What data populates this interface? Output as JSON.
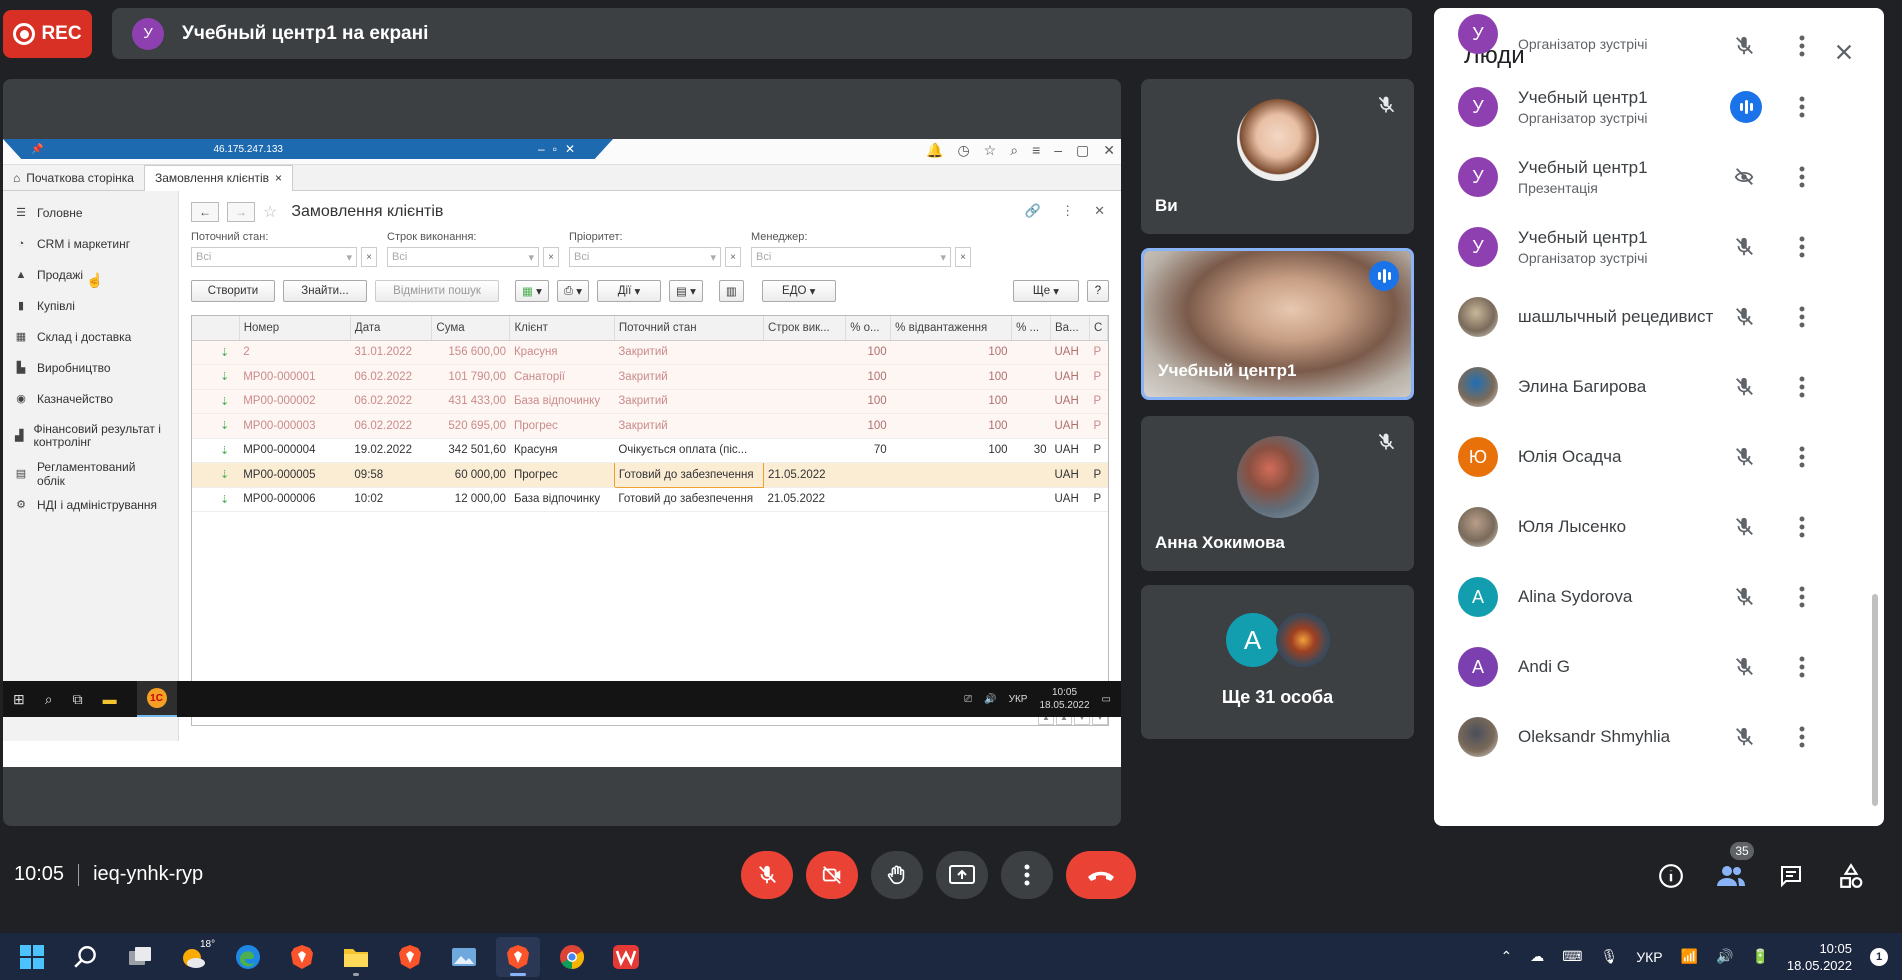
{
  "recording": {
    "label": "REC"
  },
  "presenting": {
    "avatar_letter": "У",
    "title": "Учебный центр1 на екрані"
  },
  "erp": {
    "window_title_ip": "46.175.247.133",
    "tabs": [
      "Початкова сторінка",
      "Замовлення клієнтів"
    ],
    "nav": [
      "Головне",
      "CRM і маркетинг",
      "Продажі",
      "Купівлі",
      "Склад і доставка",
      "Виробництво",
      "Казначейство",
      "Фінансовий результат і контролінг",
      "Регламентований облік",
      "НДІ і адміністрування"
    ],
    "doc_title": "Замовлення клієнтів",
    "filters": [
      {
        "label": "Поточний стан:",
        "value": "Всі"
      },
      {
        "label": "Строк виконання:",
        "value": "Всі"
      },
      {
        "label": "Пріоритет:",
        "value": "Всі"
      },
      {
        "label": "Менеджер:",
        "value": "Всі"
      }
    ],
    "toolbar": {
      "create": "Створити",
      "find": "Знайти...",
      "cancel_search": "Відмінити пошук",
      "actions": "Дії",
      "edo": "ЕДО",
      "more": "Ще",
      "help": "?"
    },
    "columns": [
      "Номер",
      "Дата",
      "Сума",
      "Клієнт",
      "Поточний стан",
      "Строк вик...",
      "% о...",
      "% відвантаження",
      "% ...",
      "Ва...",
      "С"
    ],
    "rows": [
      {
        "state": "closed",
        "cells": [
          "2",
          "31.01.2022",
          "156 600,00",
          "Красуня",
          "Закритий",
          "",
          "100",
          "100",
          "",
          "UAH",
          "Р"
        ]
      },
      {
        "state": "closed",
        "cells": [
          "МР00-000001",
          "06.02.2022",
          "101 790,00",
          "Санаторії",
          "Закритий",
          "",
          "100",
          "100",
          "",
          "UAH",
          "Р"
        ]
      },
      {
        "state": "closed",
        "cells": [
          "МР00-000002",
          "06.02.2022",
          "431 433,00",
          "База відпочинку",
          "Закритий",
          "",
          "100",
          "100",
          "",
          "UAH",
          "Р"
        ]
      },
      {
        "state": "closed",
        "cells": [
          "МР00-000003",
          "06.02.2022",
          "520 695,00",
          "Прогрес",
          "Закритий",
          "",
          "100",
          "100",
          "",
          "UAH",
          "Р"
        ]
      },
      {
        "state": "open",
        "cells": [
          "МР00-000004",
          "19.02.2022",
          "342 501,60",
          "Красуня",
          "Очікується оплата (піс...",
          "",
          "70",
          "100",
          "30",
          "UAH",
          "Р"
        ]
      },
      {
        "state": "sel",
        "cells": [
          "МР00-000005",
          "09:58",
          "60 000,00",
          "Прогрес",
          "Готовий до забезпечення",
          "21.05.2022",
          "",
          "",
          "",
          "UAH",
          "Р"
        ]
      },
      {
        "state": "open",
        "cells": [
          "МР00-000006",
          "10:02",
          "12 000,00",
          "База відпочинку",
          "Готовий до забезпечення",
          "21.05.2022",
          "",
          "",
          "",
          "UAH",
          "Р"
        ]
      }
    ],
    "taskbar": {
      "lang": "УКР",
      "time": "10:05",
      "date": "18.05.2022"
    }
  },
  "tiles": {
    "you": {
      "name": "Ви"
    },
    "speaker": {
      "name": "Учебный центр1"
    },
    "anna": {
      "name": "Анна Хокимова"
    },
    "more": {
      "letter": "A",
      "text": "Ще 31 особа"
    }
  },
  "people": {
    "title": "Люди",
    "list": [
      {
        "name": "",
        "role": "Організатор зустрічі",
        "avatar": "У",
        "color": "#8e3fb0",
        "mic": "muted"
      },
      {
        "name": "Учебный центр1",
        "role": "Організатор зустрічі",
        "avatar": "У",
        "color": "#8e3fb0",
        "mic": "speaking"
      },
      {
        "name": "Учебный центр1",
        "role": "Презентація",
        "avatar": "У",
        "color": "#8e3fb0",
        "mic": "presenting"
      },
      {
        "name": "Учебный центр1",
        "role": "Організатор зустрічі",
        "avatar": "У",
        "color": "#8e3fb0",
        "mic": "muted"
      },
      {
        "name": "шашлычный рецедивист",
        "role": "",
        "avatar": "photo",
        "color": "#c8b89a",
        "mic": "muted"
      },
      {
        "name": "Элина Багирова",
        "role": "",
        "avatar": "photo",
        "color": "#1f6fb5",
        "mic": "muted"
      },
      {
        "name": "Юлія Осадча",
        "role": "",
        "avatar": "Ю",
        "color": "#e8710a",
        "mic": "muted"
      },
      {
        "name": "Юля Лысенко",
        "role": "",
        "avatar": "photo",
        "color": "#b89f8a",
        "mic": "muted"
      },
      {
        "name": "Alina Sydorova",
        "role": "",
        "avatar": "A",
        "color": "#129eaf",
        "mic": "muted"
      },
      {
        "name": "Andi G",
        "role": "",
        "avatar": "A",
        "color": "#7b3fb0",
        "mic": "muted"
      },
      {
        "name": "Oleksandr Shmyhlia",
        "role": "",
        "avatar": "photo",
        "color": "#4a4f5a",
        "mic": "muted"
      }
    ]
  },
  "meeting": {
    "time": "10:05",
    "code": "ieq-ynhk-ryp",
    "participant_count": "35"
  },
  "windows": {
    "temp": "18°",
    "lang": "УКР",
    "time": "10:05",
    "date": "18.05.2022",
    "notifications": "1"
  }
}
